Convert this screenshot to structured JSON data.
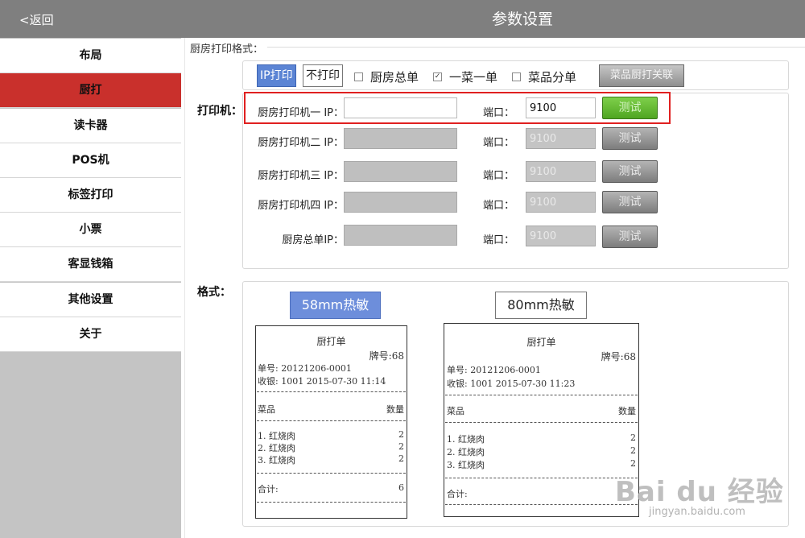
{
  "header": {
    "back_label": "<返回",
    "title": "参数设置"
  },
  "sidebar": {
    "items": [
      {
        "label": "布局",
        "active": false
      },
      {
        "label": "厨打",
        "active": true
      },
      {
        "label": "读卡器",
        "active": false
      },
      {
        "label": "POS机",
        "active": false
      },
      {
        "label": "标签打印",
        "active": false
      },
      {
        "label": "小票",
        "active": false
      },
      {
        "label": "客显钱箱",
        "active": false
      },
      {
        "label": "其他设置",
        "active": false
      },
      {
        "label": "关于",
        "active": false
      }
    ]
  },
  "kitchen": {
    "legend": "厨房打印格式：",
    "mode_ip": "IP打印",
    "mode_none": "不打印",
    "opt_total": {
      "label": "厨房总单",
      "checked": false
    },
    "opt_one_dish": {
      "label": "一菜一单",
      "checked": true
    },
    "opt_split": {
      "label": "菜品分单",
      "checked": false
    },
    "assoc_button": "菜品厨打关联",
    "printer_label": "打印机：",
    "port_label": "端口：",
    "test_label": "测试",
    "printers": [
      {
        "label": "厨房打印机一 IP：",
        "ip": "",
        "port": "9100",
        "enabled": true
      },
      {
        "label": "厨房打印机二 IP：",
        "ip": "",
        "port": "9100",
        "enabled": false
      },
      {
        "label": "厨房打印机三 IP：",
        "ip": "",
        "port": "9100",
        "enabled": false
      },
      {
        "label": "厨房打印机四 IP：",
        "ip": "",
        "port": "9100",
        "enabled": false
      },
      {
        "label": "厨房总单IP：",
        "ip": "",
        "port": "9100",
        "enabled": false
      }
    ]
  },
  "format": {
    "label": "格式：",
    "btn_58": "58mm热敏",
    "btn_80": "80mm热敏",
    "receipt_58": {
      "title": "厨打单",
      "table_no": "牌号:68",
      "order_no": "单号: 20121206-0001",
      "cashier": "收银: 1001 2015-07-30 11:14",
      "col_item": "菜品",
      "col_qty": "数量",
      "items": [
        {
          "name": "1. 红烧肉",
          "qty": "2"
        },
        {
          "name": "2. 红烧肉",
          "qty": "2"
        },
        {
          "name": "3. 红烧肉",
          "qty": "2"
        }
      ],
      "total_label": "合计:",
      "total_value": "6"
    },
    "receipt_80": {
      "title": "厨打单",
      "table_no": "牌号:68",
      "order_no": "单号: 20121206-0001",
      "cashier": "收银: 1001 2015-07-30 11:23",
      "col_item": "菜品",
      "col_qty": "数量",
      "items": [
        {
          "name": "1. 红烧肉",
          "qty": "2"
        },
        {
          "name": "2. 红烧肉",
          "qty": "2"
        },
        {
          "name": "3. 红烧肉",
          "qty": "2"
        }
      ],
      "total_label": "合计:"
    }
  },
  "watermark": {
    "brand": "Bai du 经验",
    "url": "jingyan.baidu.com"
  },
  "colors": {
    "topbar": "#7f7f7f",
    "active_tab": "#c9302c",
    "accent_blue": "#5b84d4",
    "test_green": "#5fb52f",
    "highlight_red": "#e02020"
  }
}
